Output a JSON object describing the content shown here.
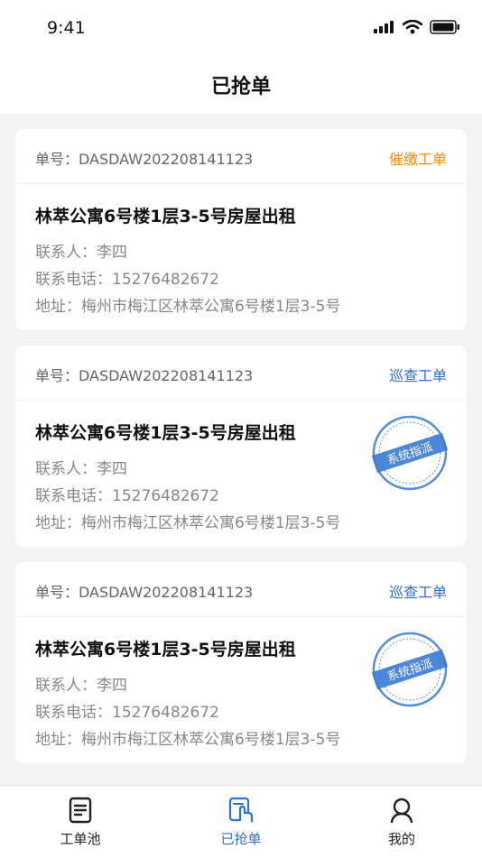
{
  "status": {
    "time": "9:41"
  },
  "header": {
    "title": "已抢单"
  },
  "orders": [
    {
      "order_no": "单号：DASDAW202208141123",
      "type": "催缴工单",
      "type_color": "#ff8c00",
      "title": "林萃公寓6号楼1层3-5号房屋出租",
      "contact": "联系人：李四",
      "phone": "联系电话：15276482672",
      "address": "地址：梅州市梅江区林萃公寓6号楼1层3-5号",
      "stamp": ""
    },
    {
      "order_no": "单号：DASDAW202208141123",
      "type": "巡查工单",
      "type_color": "#2e6fd8",
      "title": "林萃公寓6号楼1层3-5号房屋出租",
      "contact": "联系人：李四",
      "phone": "联系电话：15276482672",
      "address": "地址：梅州市梅江区林萃公寓6号楼1层3-5号",
      "stamp": "系统指派"
    },
    {
      "order_no": "单号：DASDAW202208141123",
      "type": "巡查工单",
      "type_color": "#2e6fd8",
      "title": "林萃公寓6号楼1层3-5号房屋出租",
      "contact": "联系人：李四",
      "phone": "联系电话：15276482672",
      "address": "地址：梅州市梅江区林萃公寓6号楼1层3-5号",
      "stamp": "系统指派"
    }
  ],
  "tabs": [
    {
      "label": "工单池",
      "icon": "document-icon",
      "active": false
    },
    {
      "label": "已抢单",
      "icon": "hand-grab-icon",
      "active": true
    },
    {
      "label": "我的",
      "icon": "profile-icon",
      "active": false
    }
  ],
  "colors": {
    "accent": "#2e6fd8",
    "orange": "#ff8c00",
    "stamp": "#3a7ad6"
  }
}
